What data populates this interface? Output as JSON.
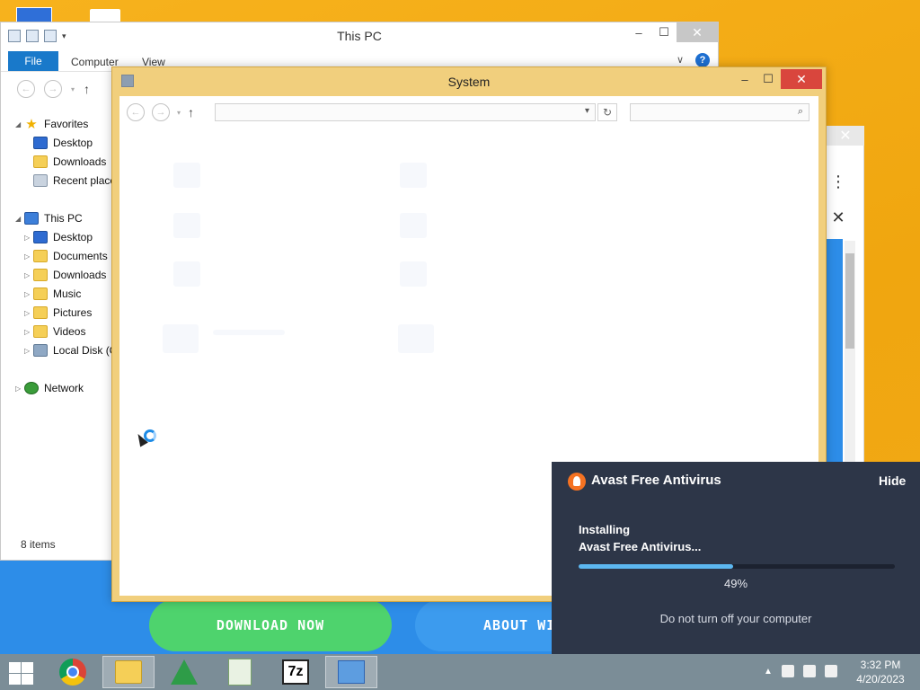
{
  "web": {
    "download_label": "DOWNLOAD NOW",
    "about_label": "ABOUT WI"
  },
  "thispc": {
    "title": "This PC",
    "tabs": [
      "File",
      "Computer",
      "View"
    ],
    "help": "?",
    "nav": [
      {
        "label": "Favorites",
        "icon": "star-icon",
        "arrow": "◢"
      },
      {
        "label": "Desktop",
        "icon": "desktop-icon"
      },
      {
        "label": "Downloads",
        "icon": "downloads-folder-icon"
      },
      {
        "label": "Recent places",
        "icon": "recent-places-icon"
      },
      {
        "label": "This PC",
        "icon": "computer-icon",
        "arrow": "◢"
      },
      {
        "label": "Desktop",
        "icon": "desktop-folder-icon",
        "arrow": "▷"
      },
      {
        "label": "Documents",
        "icon": "documents-folder-icon",
        "arrow": "▷"
      },
      {
        "label": "Downloads",
        "icon": "downloads-folder-icon",
        "arrow": "▷"
      },
      {
        "label": "Music",
        "icon": "music-folder-icon",
        "arrow": "▷"
      },
      {
        "label": "Pictures",
        "icon": "pictures-folder-icon",
        "arrow": "▷"
      },
      {
        "label": "Videos",
        "icon": "videos-folder-icon",
        "arrow": "▷"
      },
      {
        "label": "Local Disk (C:)",
        "icon": "local-disk-icon",
        "arrow": "▷"
      },
      {
        "label": "Network",
        "icon": "network-icon",
        "arrow": "▷"
      }
    ],
    "status": "8 items"
  },
  "system": {
    "title": "System"
  },
  "avast": {
    "title": "Avast Free Antivirus",
    "hide": "Hide",
    "line1": "Installing",
    "line2": "Avast Free Antivirus...",
    "progress": 0.49,
    "percent": "49%",
    "warning": "Do not turn off your computer",
    "accent": "#f57222"
  },
  "taskbar": {
    "apps": [
      "chrome-icon",
      "file-explorer-icon",
      "pyramid-app-icon",
      "notepad-plus-plus-icon",
      "7zip-icon",
      "system-window-icon"
    ],
    "sevenzip_label": "7z",
    "time": "3:32 PM",
    "date": "4/20/2023"
  }
}
